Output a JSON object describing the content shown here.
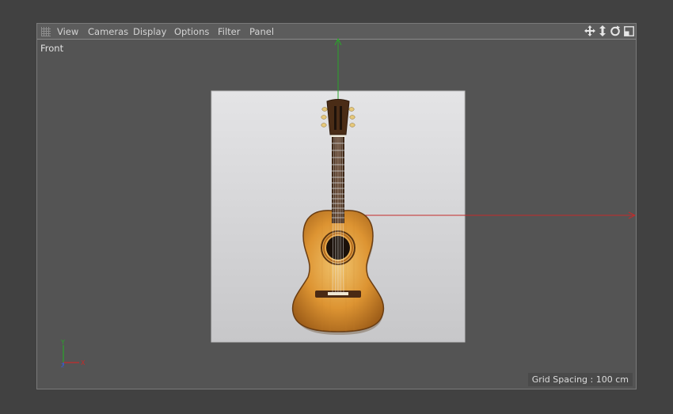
{
  "menu": {
    "items": [
      {
        "label": "View"
      },
      {
        "label": "Cameras"
      },
      {
        "label": "Display"
      },
      {
        "label": "Options"
      },
      {
        "label": "Filter"
      },
      {
        "label": "Panel"
      }
    ]
  },
  "nav_icons": [
    "move-icon",
    "dolly-icon",
    "rotate-icon",
    "maximize-view-icon"
  ],
  "viewport": {
    "view_name": "Front",
    "grid_spacing": "Grid Spacing : 100 cm"
  },
  "axis_gizmo": {
    "y_label": "Y",
    "x_label": "X",
    "z_label": "Z"
  },
  "colors": {
    "y_axis": "#2aa52a",
    "x_axis": "#c42a2a",
    "z_axis": "#3a5bd0",
    "guitar_wood": "#d9912f",
    "background_plane": "#d6d6d8"
  }
}
